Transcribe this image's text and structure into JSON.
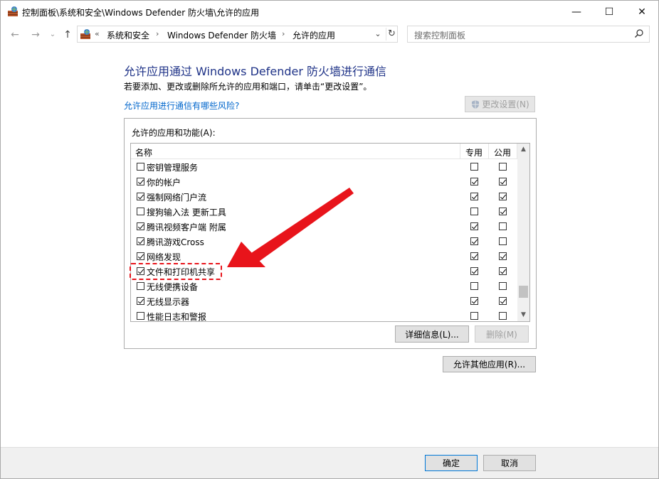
{
  "window": {
    "title": "控制面板\\系统和安全\\Windows Defender 防火墙\\允许的应用",
    "minimize_glyph": "—",
    "maximize_glyph": "☐",
    "close_glyph": "✕"
  },
  "nav": {
    "back_glyph": "←",
    "forward_glyph": "→",
    "recent_glyph": "⌄",
    "up_glyph": "↑"
  },
  "address": {
    "overflow": "«",
    "segments": [
      "系统和安全",
      "Windows Defender 防火墙",
      "允许的应用"
    ],
    "separator": "›",
    "dropdown_glyph": "⌄",
    "refresh_glyph": "↻"
  },
  "search": {
    "placeholder": "搜索控制面板"
  },
  "main": {
    "heading": "允许应用通过 Windows Defender 防火墙进行通信",
    "subtext": "若要添加、更改或删除所允许的应用和端口，请单击“更改设置”。",
    "risk_link": "允许应用进行通信有哪些风险?",
    "change_settings_label": "更改设置(N)",
    "group_label": "允许的应用和功能(A):",
    "columns": {
      "name": "名称",
      "private": "专用",
      "public": "公用"
    },
    "rows": [
      {
        "name": "密钥管理服务",
        "enabled": false,
        "private": false,
        "public": false
      },
      {
        "name": "你的帐户",
        "enabled": true,
        "private": true,
        "public": true
      },
      {
        "name": "强制网络门户流",
        "enabled": true,
        "private": true,
        "public": true
      },
      {
        "name": "搜狗输入法 更新工具",
        "enabled": false,
        "private": false,
        "public": true
      },
      {
        "name": "腾讯视频客户端 附属",
        "enabled": true,
        "private": true,
        "public": false
      },
      {
        "name": "腾讯游戏Cross",
        "enabled": true,
        "private": true,
        "public": false
      },
      {
        "name": "网络发现",
        "enabled": true,
        "private": true,
        "public": true
      },
      {
        "name": "文件和打印机共享",
        "enabled": true,
        "private": true,
        "public": true
      },
      {
        "name": "无线便携设备",
        "enabled": false,
        "private": false,
        "public": false
      },
      {
        "name": "无线显示器",
        "enabled": true,
        "private": true,
        "public": true
      },
      {
        "name": "性能日志和警报",
        "enabled": false,
        "private": false,
        "public": false
      }
    ],
    "details_label": "详细信息(L)...",
    "remove_label": "删除(M)",
    "allow_other_label": "允许其他应用(R)..."
  },
  "footer": {
    "ok_label": "确定",
    "cancel_label": "取消"
  },
  "annotation": {
    "color": "#e8141b"
  }
}
